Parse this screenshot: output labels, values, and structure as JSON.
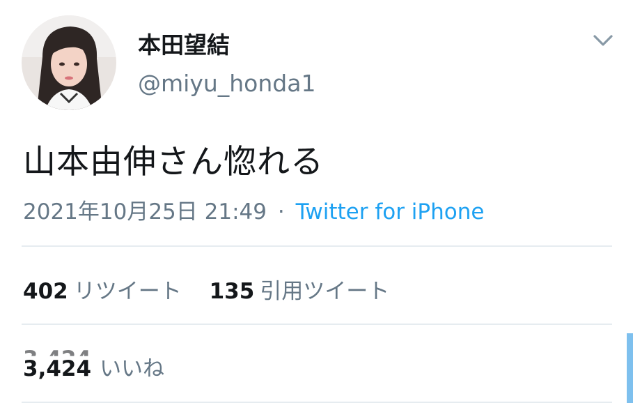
{
  "user": {
    "display_name": "本田望結",
    "handle": "@miyu_honda1"
  },
  "tweet": {
    "text": "山本由伸さん惚れる",
    "timestamp": "2021年10月25日 21:49",
    "separator": "·",
    "source": "Twitter for iPhone"
  },
  "stats": {
    "retweets": {
      "count": "402",
      "label": "リツイート"
    },
    "quotes": {
      "count": "135",
      "label": "引用ツイート"
    },
    "likes": {
      "count": "3,424",
      "label": "いいね"
    }
  },
  "icons": {
    "menu": "chevron-down-icon"
  },
  "colors": {
    "primary_text": "#14171a",
    "secondary_text": "#657786",
    "link": "#1da1f2",
    "divider": "#e6ecf0"
  }
}
